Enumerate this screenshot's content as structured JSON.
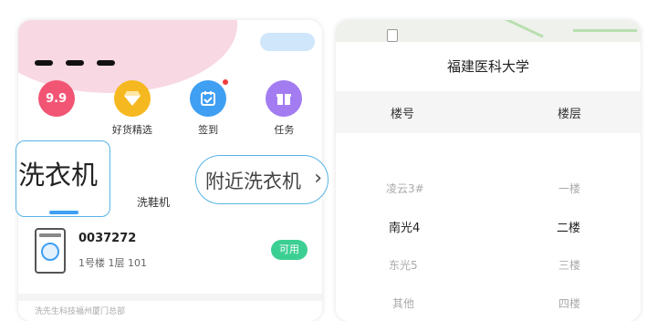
{
  "left_screen": {
    "quick_actions": [
      {
        "icon": "9.9",
        "label": ""
      },
      {
        "icon": "gem-icon",
        "label": "好货精选"
      },
      {
        "icon": "calendar-check-icon",
        "label": "签到"
      },
      {
        "icon": "gift-icon",
        "label": "任务"
      }
    ],
    "tabs": {
      "washing_machine_zoom": "洗衣机",
      "shoe_washer": "洗鞋机",
      "nearby_zoom": "附近洗衣机",
      "nearby_arrow": "›"
    },
    "machine": {
      "id": "0037272",
      "location": "1号楼 1层 101",
      "status": "可用"
    },
    "footer_text": "洗先生科技福州厦门总部"
  },
  "right_screen": {
    "title": "福建医科大学",
    "columns": [
      "楼号",
      "楼层"
    ],
    "buildings": [
      "凌云3#",
      "南光4",
      "东光5",
      "其他"
    ],
    "floors": [
      "一楼",
      "二楼",
      "三楼",
      "四楼"
    ]
  },
  "colors": {
    "accent_blue": "#3f9ff3",
    "available_green": "#3ccf93",
    "pink_9_9": "#f25574",
    "gold": "#f6b820",
    "purple": "#a37cf1"
  }
}
